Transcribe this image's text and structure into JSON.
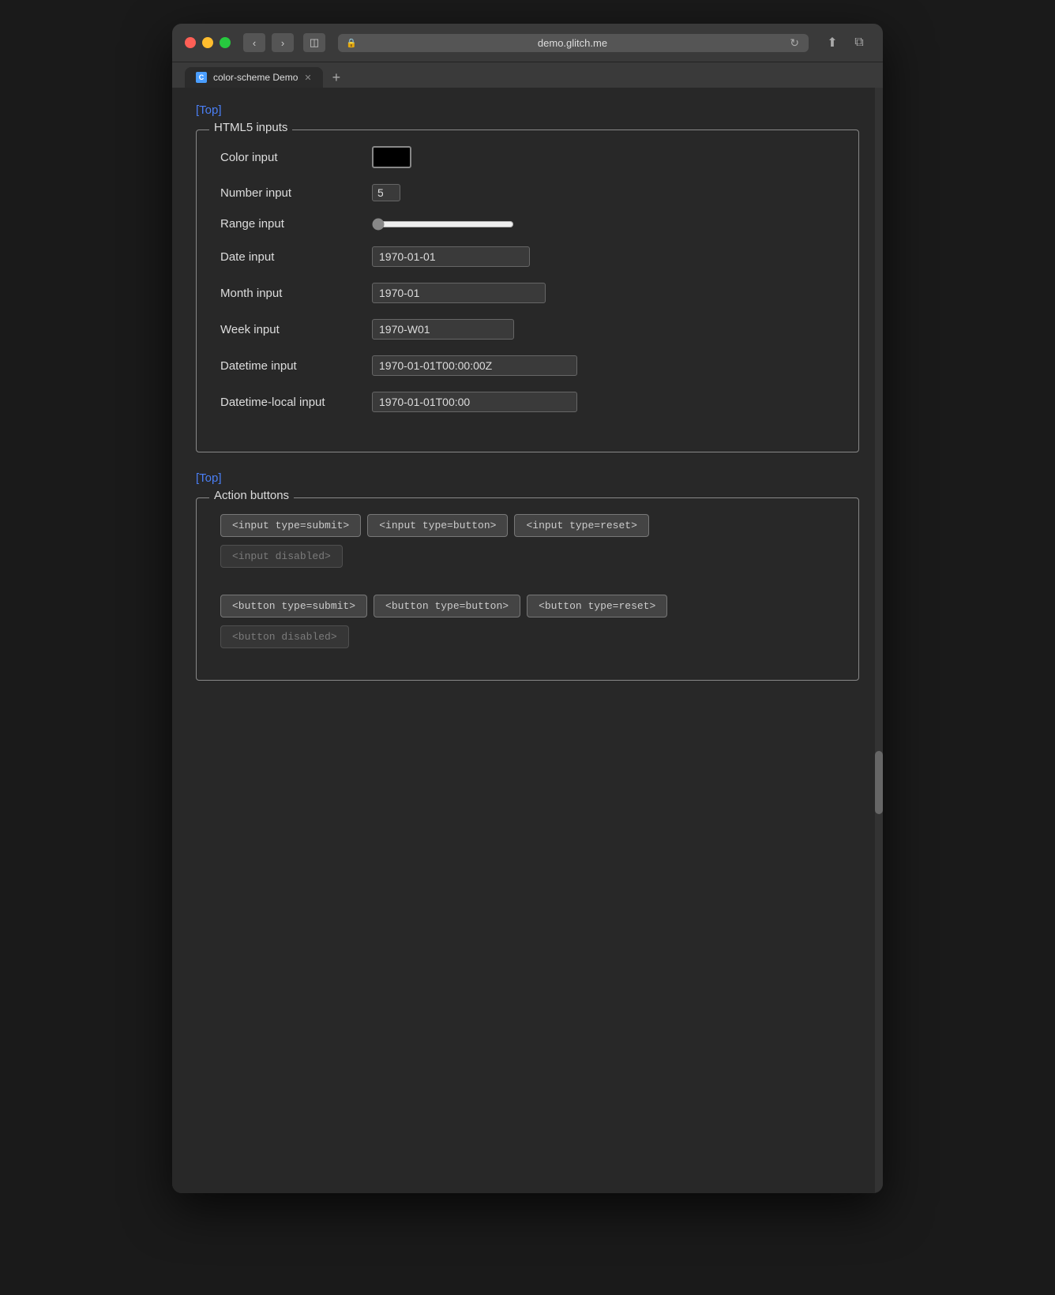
{
  "browser": {
    "url": "demo.glitch.me",
    "tab_title": "color-scheme Demo",
    "tab_favicon": "C",
    "back_btn": "‹",
    "forward_btn": "›",
    "sidebar_btn": "⊞",
    "menu_btn": "≡",
    "reload_btn": "↻",
    "share_btn": "⬆",
    "duplicate_btn": "⧉",
    "new_tab_btn": "+"
  },
  "page": {
    "top_link": "[Top]",
    "top_link2": "[Top]"
  },
  "html5_section": {
    "legend": "HTML5 inputs",
    "color_label": "Color input",
    "color_value": "#000000",
    "number_label": "Number input",
    "number_value": "5",
    "range_label": "Range input",
    "range_value": "0",
    "date_label": "Date input",
    "date_value": "1970-01-01",
    "month_label": "Month input",
    "month_value": "1970-01",
    "week_label": "Week input",
    "week_value": "1970-W01",
    "datetime_label": "Datetime input",
    "datetime_value": "1970-01-01T00:00:00Z",
    "datetime_local_label": "Datetime-local input",
    "datetime_local_value": "1970-01-01T00:00"
  },
  "action_section": {
    "legend": "Action buttons",
    "btn_input_submit": "<input type=submit>",
    "btn_input_button": "<input type=button>",
    "btn_input_reset": "<input type=reset>",
    "btn_input_disabled": "<input disabled>",
    "btn_button_submit": "<button type=submit>",
    "btn_button_button": "<button type=button>",
    "btn_button_reset": "<button type=reset>",
    "btn_button_disabled": "<button disabled>"
  }
}
